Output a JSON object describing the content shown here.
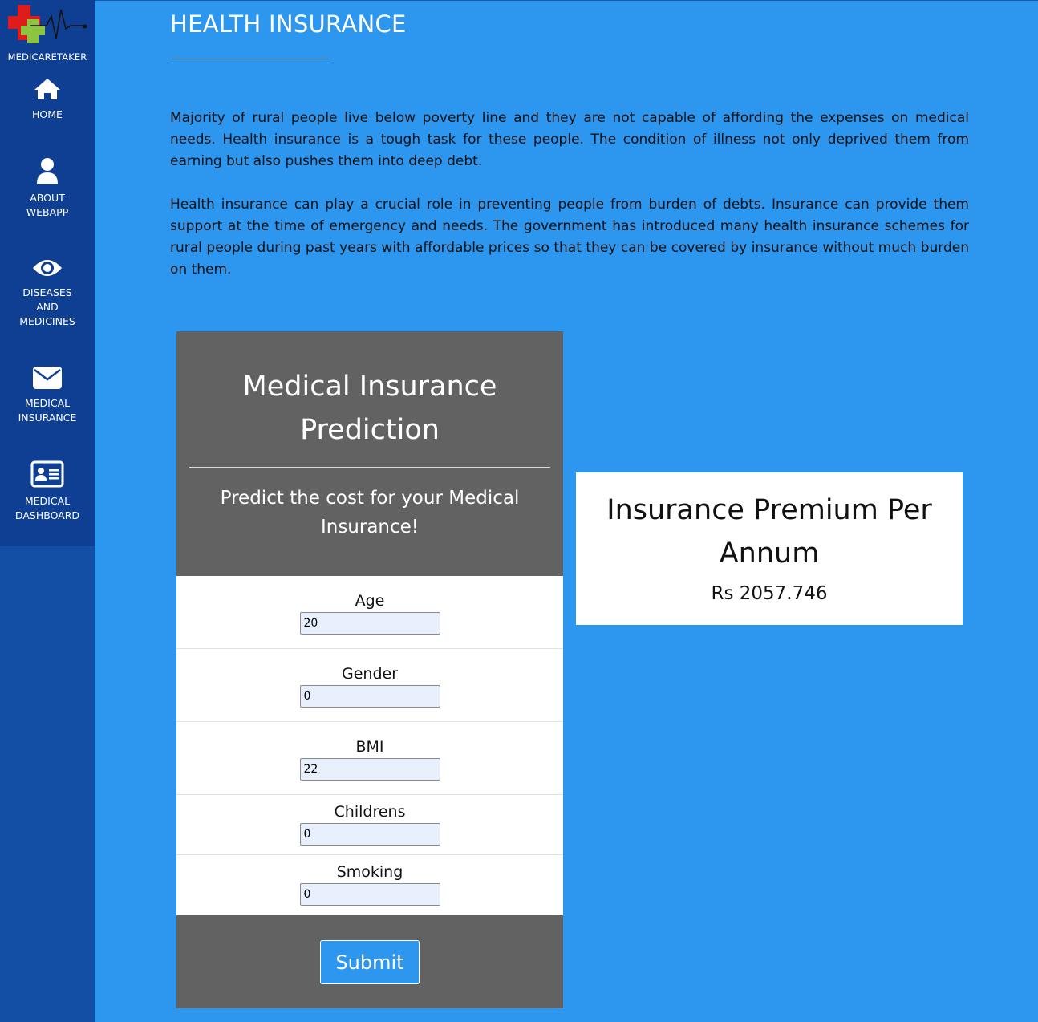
{
  "sidebar": {
    "brand": "MEDICARETAKER",
    "items": [
      {
        "label": "HOME",
        "icon": "home-icon"
      },
      {
        "label": "ABOUT\nWEBAPP",
        "icon": "user-icon"
      },
      {
        "label": "DISEASES\nAND\nMEDICINES",
        "icon": "eye-icon"
      },
      {
        "label": "MEDICAL\nINSURANCE",
        "icon": "envelope-icon"
      },
      {
        "label": "MEDICAL\nDASHBOARD",
        "icon": "id-card-icon"
      }
    ]
  },
  "header": {
    "title": "HEALTH INSURANCE"
  },
  "content": {
    "paragraph1": "Majority of rural people live below poverty line and they are not capable of affording the expenses on medical needs. Health insurance is a tough task for these people. The condition of illness not only deprived them from earning but also pushes them into deep debt.",
    "paragraph2": "Health insurance can play a crucial role in preventing people from burden of debts. Insurance can provide them support at the time of emergency and needs. The government has introduced many health insurance schemes for rural people during past years with affordable prices so that they can be covered by insurance without much burden on them."
  },
  "form": {
    "title": "Medical Insurance Prediction",
    "subtitle": "Predict the cost for your Medical Insurance!",
    "fields": [
      {
        "label": "Age",
        "value": "20"
      },
      {
        "label": "Gender",
        "value": "0"
      },
      {
        "label": "BMI",
        "value": "22"
      },
      {
        "label": "Childrens",
        "value": "0"
      },
      {
        "label": "Smoking",
        "value": "0"
      }
    ],
    "submit_label": "Submit"
  },
  "result": {
    "title": "Insurance Premium Per Annum",
    "value": "Rs 2057.746"
  },
  "colors": {
    "background": "#2d96ef",
    "sidebar": "#0f3f93",
    "card_header": "#626262"
  }
}
